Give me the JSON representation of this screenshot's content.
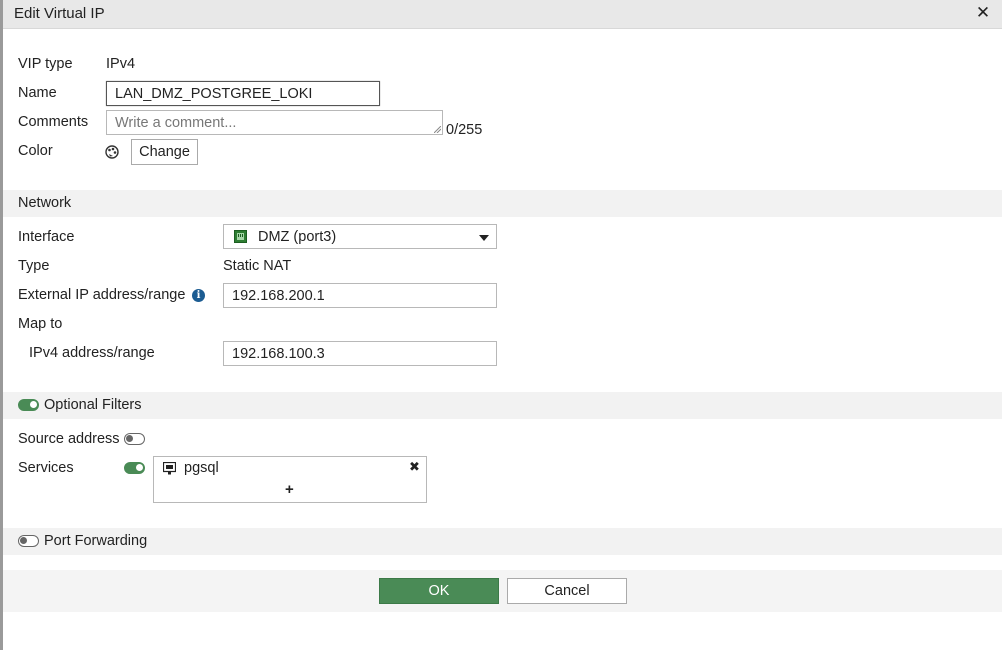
{
  "dialog": {
    "title": "Edit Virtual IP"
  },
  "general": {
    "vip_type_label": "VIP type",
    "vip_type_value": "IPv4",
    "name_label": "Name",
    "name_value": "LAN_DMZ_POSTGREE_LOKI",
    "comments_label": "Comments",
    "comments_placeholder": "Write a comment...",
    "comments_counter": "0/255",
    "color_label": "Color",
    "color_change_label": "Change"
  },
  "network": {
    "section_label": "Network",
    "interface_label": "Interface",
    "interface_value": "DMZ (port3)",
    "type_label": "Type",
    "type_value": "Static NAT",
    "external_ip_label": "External IP address/range",
    "external_ip_value": "192.168.200.1",
    "map_to_label": "Map to",
    "ipv4_range_label": "IPv4 address/range",
    "ipv4_range_value": "192.168.100.3"
  },
  "filters": {
    "section_label": "Optional Filters",
    "enabled": true,
    "source_address_label": "Source address",
    "source_address_enabled": false,
    "services_label": "Services",
    "services_enabled": true,
    "services_items": [
      "pgsql"
    ],
    "add_symbol": "+",
    "remove_symbol": "✖"
  },
  "port_forwarding": {
    "section_label": "Port Forwarding",
    "enabled": false
  },
  "footer": {
    "ok_label": "OK",
    "cancel_label": "Cancel"
  }
}
